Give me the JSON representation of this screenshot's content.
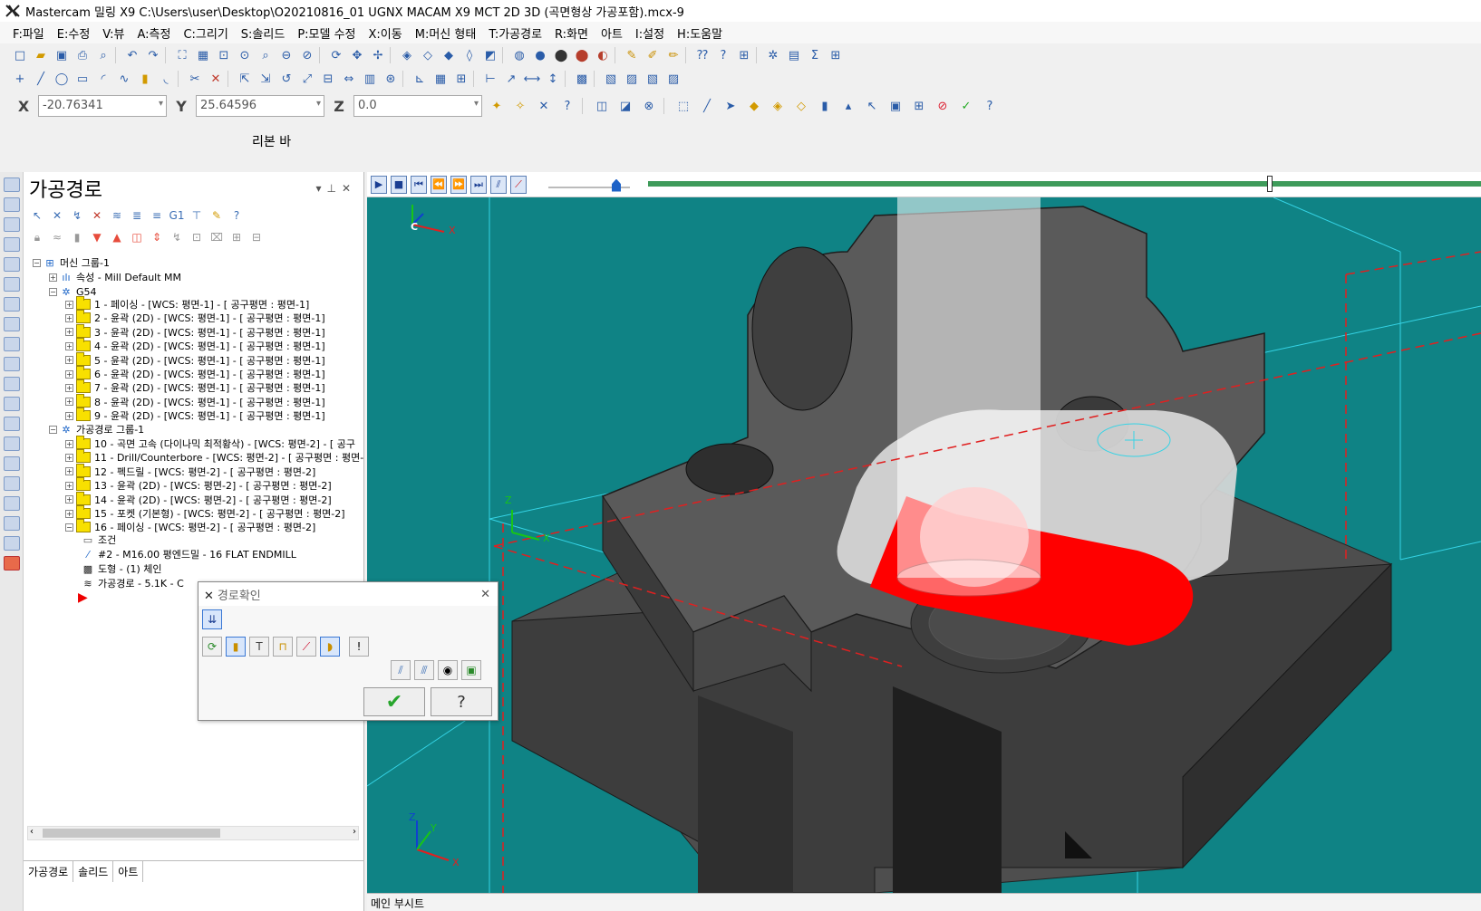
{
  "window": {
    "title": "Mastercam 밀링 X9   C:\\Users\\user\\Desktop\\O20210816_01 UGNX MACAM X9 MCT 2D 3D (곡면형상 가공포함).mcx-9"
  },
  "menu": [
    "F:파일",
    "E:수정",
    "V:뷰",
    "A:측정",
    "C:그리기",
    "S:솔리드",
    "P:모델 수정",
    "X:이동",
    "M:머신 형태",
    "T:가공경로",
    "R:화면",
    "아트",
    "I:설정",
    "H:도움말"
  ],
  "coords": {
    "x_label": "X",
    "x_value": "-20.76341",
    "y_label": "Y",
    "y_value": "25.64596",
    "z_label": "Z",
    "z_value": "0.0"
  },
  "ribbon_label": "리본 바",
  "panel": {
    "title": "가공경로",
    "tabs": [
      "가공경로",
      "솔리드",
      "아트"
    ]
  },
  "tree": {
    "machine_group": "머신 그룹-1",
    "properties": "속성 - Mill Default MM",
    "wcs": "G54",
    "ops1": [
      "1 - 페이싱 - [WCS: 평면-1] - [ 공구평면 : 평면-1]",
      "2 - 윤곽 (2D) - [WCS: 평면-1] - [ 공구평면 : 평면-1]",
      "3 - 윤곽 (2D) - [WCS: 평면-1] - [ 공구평면 : 평면-1]",
      "4 - 윤곽 (2D) - [WCS: 평면-1] - [ 공구평면 : 평면-1]",
      "5 - 윤곽 (2D) - [WCS: 평면-1] - [ 공구평면 : 평면-1]",
      "6 - 윤곽 (2D) - [WCS: 평면-1] - [ 공구평면 : 평면-1]",
      "7 - 윤곽 (2D) - [WCS: 평면-1] - [ 공구평면 : 평면-1]",
      "8 - 윤곽 (2D) - [WCS: 평면-1] - [ 공구평면 : 평면-1]",
      "9 - 윤곽 (2D) - [WCS: 평면-1] - [ 공구평면 : 평면-1]"
    ],
    "toolpath_group": "가공경로 그룹-1",
    "ops2": [
      "10 - 곡면 고속 (다이나믹 최적황삭) - [WCS: 평면-2] - [ 공구",
      "11 - Drill/Counterbore - [WCS: 평면-2] - [ 공구평면 : 평면-",
      "12 - 펙드릴 - [WCS: 평면-2] - [ 공구평면 : 평면-2]",
      "13 - 윤곽 (2D) - [WCS: 평면-2] - [ 공구평면 : 평면-2]",
      "14 - 윤곽 (2D) - [WCS: 평면-2] - [ 공구평면 : 평면-2]",
      "15 - 포켓 (기본형) - [WCS: 평면-2] - [ 공구평면 : 평면-2]",
      "16 - 페이싱 - [WCS: 평면-2] - [ 공구평면 : 평면-2]"
    ],
    "children": [
      "조건",
      "#2 - M16.00 평엔드밀 - 16 FLAT ENDMILL",
      "도형 - (1) 체인",
      "가공경로 - 5.1K - C"
    ]
  },
  "dialog": {
    "title": "경로확인",
    "ok_glyph": "✔",
    "help_glyph": "?"
  },
  "viewport": {
    "axis_top_c": "C",
    "axis_top_x": "X",
    "axis_mid_z": "Z",
    "axis_mid_x": "X",
    "axis_bot_y": "Y",
    "axis_bot_x": "X",
    "axis_bot_z": "Z"
  },
  "status": {
    "text": "메인 부시트"
  },
  "colors": {
    "viewport_bg": "#0f8385",
    "part": "#555555",
    "cut_region": "#ff0000",
    "progress": "#3e9b5a"
  }
}
